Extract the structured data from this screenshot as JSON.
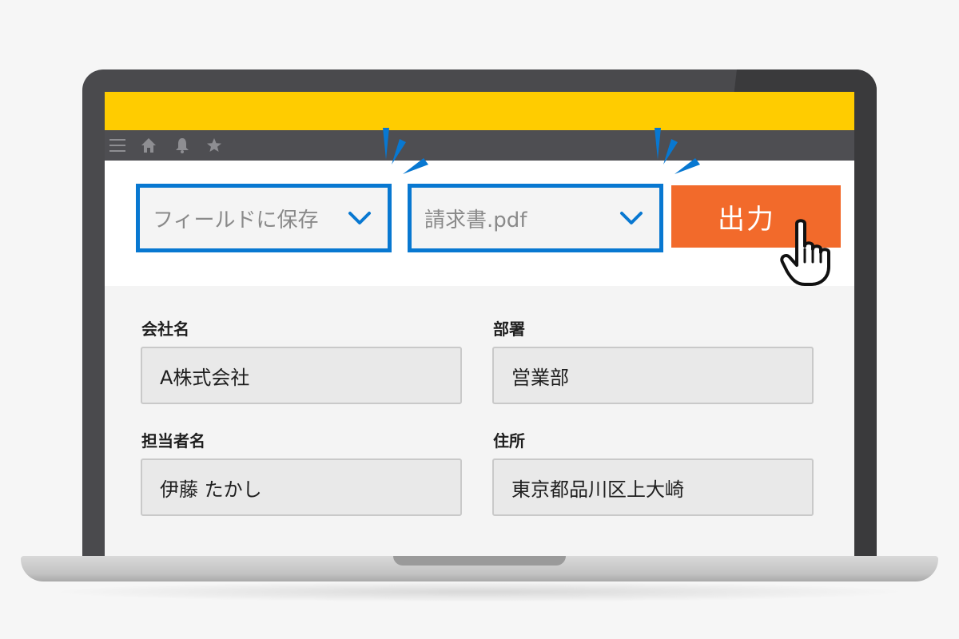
{
  "colors": {
    "accent_yellow": "#ffcc00",
    "select_border": "#0878d1",
    "export_button": "#f26a2b",
    "nav_bar": "#4e4e52"
  },
  "nav": {
    "icons": [
      "menu-icon",
      "home-icon",
      "bell-icon",
      "star-icon"
    ]
  },
  "toolbar": {
    "field_select_text": "フィールドに保存",
    "file_select_text": "請求書.pdf",
    "export_label": "出力"
  },
  "form": {
    "fields": [
      {
        "label": "会社名",
        "value": "A株式会社"
      },
      {
        "label": "部署",
        "value": "営業部"
      },
      {
        "label": "担当者名",
        "value": "伊藤 たかし"
      },
      {
        "label": "住所",
        "value": "東京都品川区上大崎"
      }
    ]
  }
}
